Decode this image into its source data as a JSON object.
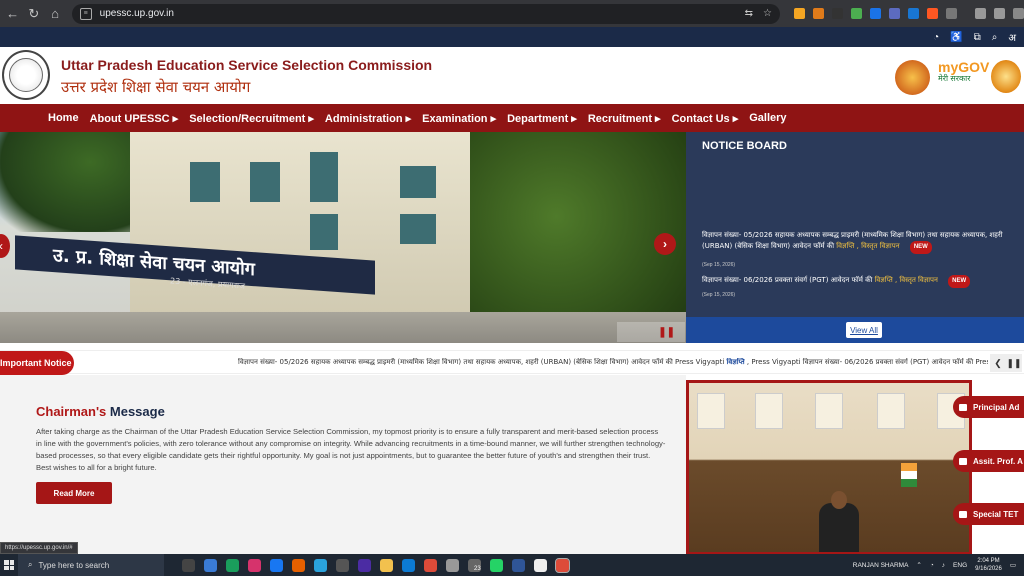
{
  "browser": {
    "url": "upessc.up.gov.in",
    "status_url": "https://upessc.up.gov.in/#"
  },
  "header": {
    "title_en": "Uttar Pradesh Education Service Selection Commission",
    "title_hi": "उत्तर प्रदेश शिक्षा सेवा चयन आयोग",
    "mygov_top": "myGOV",
    "mygov_sub": "मेरी सरकार"
  },
  "menu": {
    "items": [
      "Home",
      "About UPESSC ▸",
      "Selection/Recruitment ▸",
      "Administration ▸",
      "Examination ▸",
      "Department ▸",
      "Recruitment ▸",
      "Contact Us ▸",
      "Gallery"
    ]
  },
  "slider": {
    "banner_text": "उ. प्र. शिक्षा सेवा चयन आयोग",
    "banner_sub": "23 - एलनगंज, प्रयागराज"
  },
  "notice_board": {
    "title": "NOTICE BOARD",
    "items": [
      {
        "text": "विज्ञापन संख्या- 05/2026 सहायक अध्यापक सम्बद्ध प्राइमरी (माध्यमिक शिक्षा विभाग) तथा सहायक अध्यापक, शहरी (URBAN) (बेसिक शिक्षा विभाग) आवेदन फॉर्म की",
        "links": "विज्ञप्ति , विस्तृत विज्ञापन",
        "badge": "NEW",
        "date": "(Sep 15, 2026)"
      },
      {
        "text": "विज्ञापन संख्या- 06/2026 प्रवक्ता संवर्ग (PGT) आवेदन फॉर्म की",
        "links": "विज्ञप्ति , विस्तृत विज्ञापन",
        "badge": "NEW",
        "date": "(Sep 15, 2026)"
      }
    ],
    "view_all": "View All"
  },
  "ticker": {
    "label": "Important Notice",
    "text_a": "विज्ञापन संख्या- 05/2026 सहायक अध्यापक सम्बद्ध प्राइमरी (माध्यमिक शिक्षा विभाग) तथा सहायक अध्यापक, शहरी (URBAN) (बेसिक शिक्षा विभाग) आवेदन फॉर्म की Press Vigyapti ",
    "text_link": "विज्ञप्ति",
    "text_b": " , Press Vigyapti   विज्ञापन संख्या- 06/2026 प्रवक्ता संवर्ग (PGT) आवेदन फॉर्म की Press Vigy"
  },
  "chairman": {
    "title_a": "Chairman's",
    "title_b": " Message",
    "text": "After taking charge as the Chairman of the Uttar Pradesh Education Service Selection Commission, my topmost priority is to ensure a fully transparent and merit-based selection process in line with the government's policies, with zero tolerance without any compromise on integrity. While advancing recruitments in a time-bound manner, we will further strengthen technology-based processes, so that every eligible candidate gets their rightful opportunity. My goal is not just appointments, but to guarantee the better future of youth's and strengthen their trust. Best wishes to all for a bright future.",
    "read_more": "Read More"
  },
  "side_tabs": [
    "Principal Ad",
    "Assit. Prof. A",
    "Special TET"
  ],
  "taskbar": {
    "search_placeholder": "Type here to search",
    "user": "RANJAN SHARMA",
    "lang": "ENG",
    "time": "2:04 PM",
    "date": "9/16/2026",
    "badge_23": "23"
  },
  "colors": {
    "brand_red": "#8f1414",
    "navy": "#1b2a48"
  }
}
